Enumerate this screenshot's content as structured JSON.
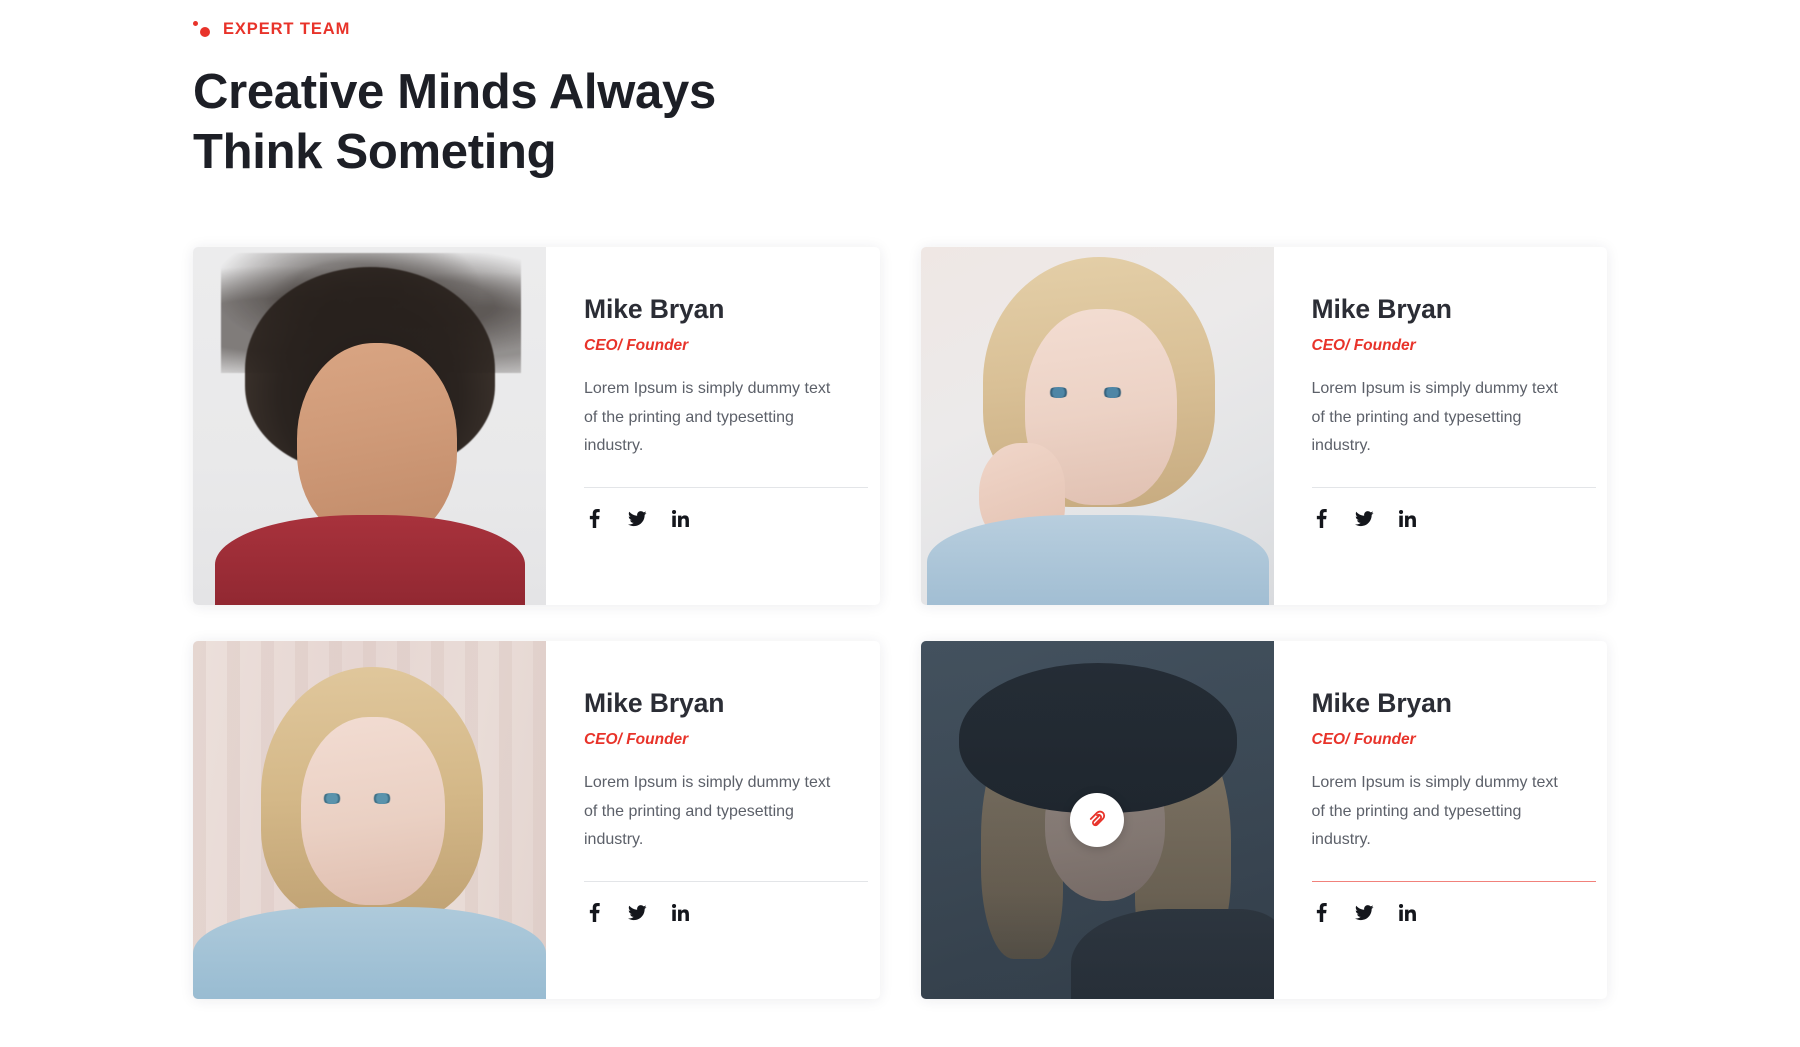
{
  "section": {
    "eyebrow": "EXPERT TEAM",
    "headline_line1": "Creative Minds Always",
    "headline_line2": "Think Someting",
    "accent_color": "#e8332a",
    "heading_color": "#1d1f26"
  },
  "social_labels": {
    "facebook": "f",
    "twitter": "twitter-bird",
    "linkedin": "in"
  },
  "cards": [
    {
      "name": "Mike Bryan",
      "role": "CEO/ Founder",
      "description": "Lorem Ipsum is simply dummy text of the printing and typesetting industry.",
      "divider_state": "default",
      "photo_alt": "smiling-man-portrait",
      "badge": null
    },
    {
      "name": "Mike Bryan",
      "role": "CEO/ Founder",
      "description": "Lorem Ipsum is simply dummy text of the printing and typesetting industry.",
      "divider_state": "default",
      "photo_alt": "blonde-woman-hand-on-chin-portrait",
      "badge": null
    },
    {
      "name": "Mike Bryan",
      "role": "CEO/ Founder",
      "description": "Lorem Ipsum is simply dummy text of the printing and typesetting industry.",
      "divider_state": "default",
      "photo_alt": "blonde-woman-blue-hoodie-portrait",
      "badge": null
    },
    {
      "name": "Mike Bryan",
      "role": "CEO/ Founder",
      "description": "Lorem Ipsum is simply dummy text of the printing and typesetting industry.",
      "divider_state": "accent",
      "photo_alt": "woman-with-black-hat-portrait",
      "badge": "link-paperclip-icon"
    }
  ]
}
